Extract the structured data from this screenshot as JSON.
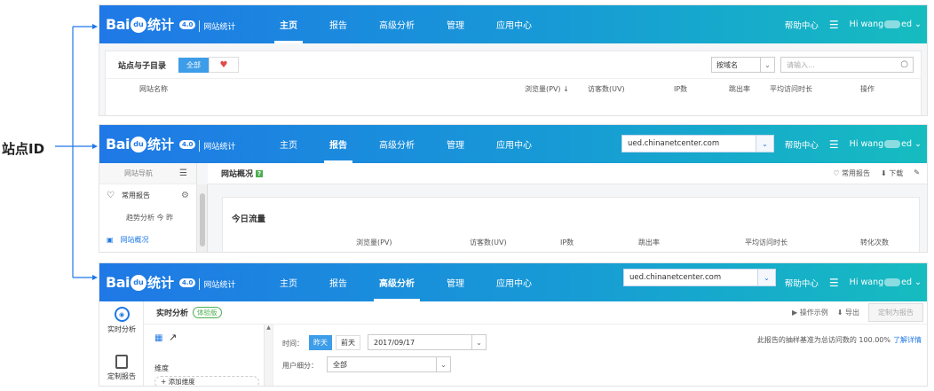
{
  "side_label": "站点ID",
  "panels": [
    {
      "logo": {
        "brand": "Bai",
        "paw": "du",
        "suffix": "统计",
        "version": "4.0",
        "subtitle": "网站统计"
      },
      "nav": [
        "主页",
        "报告",
        "高级分析",
        "管理",
        "应用中心"
      ],
      "active": "主页",
      "help": "帮助中心",
      "menu_icon": "☰",
      "user_prefix": "Hi  wang",
      "user_suffix": "ed",
      "card": {
        "title": "站点与子目录",
        "tag_all": "全部",
        "fav_icon": "♥",
        "select_value": "按域名",
        "search_placeholder": "请输入...",
        "search_icon": "○",
        "columns": [
          "网站名称",
          "浏览量(PV) ↓",
          "访客数(UV)",
          "IP数",
          "跳出率",
          "平均访问时长",
          "操作"
        ]
      }
    },
    {
      "logo": {
        "brand": "Bai",
        "paw": "du",
        "suffix": "统计",
        "version": "4.0",
        "subtitle": "网站统计"
      },
      "nav": [
        "主页",
        "报告",
        "高级分析",
        "管理",
        "应用中心"
      ],
      "active": "报告",
      "domain": "ued.chinanetcenter.com",
      "help": "帮助中心",
      "menu_icon": "☰",
      "user_prefix": "Hi  wang",
      "user_suffix": "ed",
      "left_nav": {
        "header": "网站导航",
        "header_icon": "☰",
        "items": [
          {
            "icon": "♡",
            "label": "常用报告",
            "gear": "⚙"
          },
          {
            "icon": "",
            "label": "趋势分析  今  昨",
            "gear": ""
          },
          {
            "icon": "▣",
            "label": "网站概况",
            "gear": ""
          }
        ]
      },
      "page_title": "网站概况",
      "help_badge": "?",
      "tools": [
        "♡ 常用报告",
        "⬇ 下载",
        "✎"
      ],
      "card_title": "今日流量",
      "columns": [
        "浏览量(PV)",
        "访客数(UV)",
        "IP数",
        "跳出率",
        "平均访问时长",
        "转化次数"
      ]
    },
    {
      "logo": {
        "brand": "Bai",
        "paw": "du",
        "suffix": "统计",
        "version": "4.0",
        "subtitle": "网站统计"
      },
      "nav": [
        "主页",
        "报告",
        "高级分析",
        "管理",
        "应用中心"
      ],
      "active": "高级分析",
      "domain": "ued.chinanetcenter.com",
      "help": "帮助中心",
      "menu_icon": "☰",
      "user_prefix": "Hi  wang",
      "user_suffix": "ed",
      "left_tools": [
        {
          "label": "实时分析",
          "icon": "◉"
        },
        {
          "label": "定制报告",
          "icon": "≡"
        }
      ],
      "page_title": "实时分析",
      "trial_badge": "体验版",
      "tools": [
        "▶ 操作示例",
        "⬇ 导出"
      ],
      "custom_button": "定制为报告",
      "dim_label": "维度",
      "add_dim": "+ 添加维度",
      "time_label": "时间：",
      "time_buttons": [
        "昨天",
        "前天"
      ],
      "date_value": "2017/09/17",
      "user_filter_label": "用户细分：",
      "user_filter_value": "全部",
      "note": "此报告的抽样基准为总访问数的 100.00%",
      "note_link": "了解详情",
      "table_icon": "▦",
      "trend_icon": "↗"
    }
  ]
}
